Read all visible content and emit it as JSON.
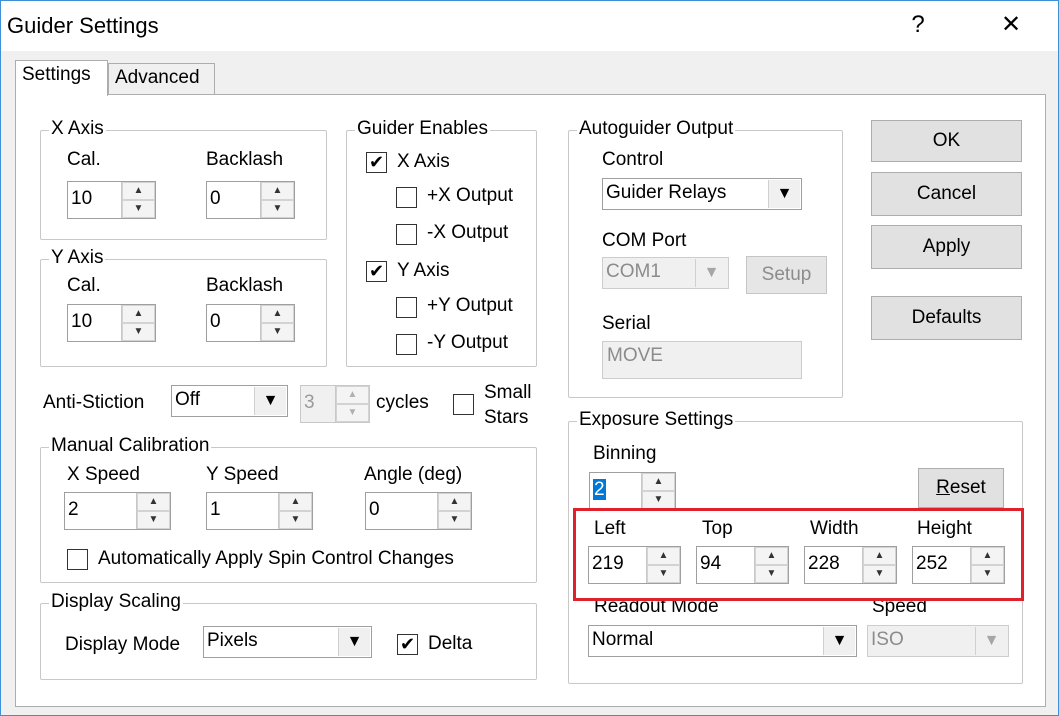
{
  "window": {
    "title": "Guider Settings",
    "help_label": "?",
    "close_label": "✕"
  },
  "tabs": [
    {
      "label": "Settings",
      "active": true
    },
    {
      "label": "Advanced",
      "active": false
    }
  ],
  "x_axis": {
    "group": "X Axis",
    "cal_label": "Cal.",
    "cal_value": "10",
    "backlash_label": "Backlash",
    "backlash_value": "0"
  },
  "y_axis": {
    "group": "Y Axis",
    "cal_label": "Cal.",
    "cal_value": "10",
    "backlash_label": "Backlash",
    "backlash_value": "0"
  },
  "guider_enables": {
    "group": "Guider Enables",
    "x_axis": {
      "label": "X Axis",
      "checked": true
    },
    "plus_x": {
      "label": "+X Output",
      "checked": false
    },
    "minus_x": {
      "label": "-X Output",
      "checked": false
    },
    "y_axis": {
      "label": "Y Axis",
      "checked": true
    },
    "plus_y": {
      "label": "+Y Output",
      "checked": false
    },
    "minus_y": {
      "label": "-Y Output",
      "checked": false
    }
  },
  "anti_stiction": {
    "label": "Anti-Stiction",
    "mode": "Off",
    "cycles_value": "3",
    "cycles_label": "cycles",
    "small_stars_label_1": "Small",
    "small_stars_label_2": "Stars"
  },
  "manual_calibration": {
    "group": "Manual Calibration",
    "x_speed_label": "X Speed",
    "x_speed_value": "2",
    "y_speed_label": "Y Speed",
    "y_speed_value": "1",
    "angle_label": "Angle (deg)",
    "angle_value": "0",
    "auto_apply_label": "Automatically Apply Spin Control Changes"
  },
  "display_scaling": {
    "group": "Display Scaling",
    "mode_label": "Display Mode",
    "mode_value": "Pixels",
    "delta_label": "Delta"
  },
  "autoguider_output": {
    "group": "Autoguider Output",
    "control_label": "Control",
    "control_value": "Guider Relays",
    "com_port_label": "COM Port",
    "com_port_value": "COM1",
    "setup_label": "Setup",
    "serial_label": "Serial",
    "serial_value": "MOVE"
  },
  "exposure_settings": {
    "group": "Exposure Settings",
    "binning_label": "Binning",
    "binning_value": "2",
    "reset_label_underlined": "R",
    "reset_label_rest": "eset",
    "left_label": "Left",
    "left_value": "219",
    "top_label": "Top",
    "top_value": "94",
    "width_label": "Width",
    "width_value": "228",
    "height_label": "Height",
    "height_value": "252",
    "readout_label": "Readout Mode",
    "readout_value": "Normal",
    "speed_label": "Speed",
    "speed_value": "ISO"
  },
  "buttons": {
    "ok": "OK",
    "cancel": "Cancel",
    "apply": "Apply",
    "defaults": "Defaults"
  },
  "icons": {
    "up_arrow": "▲",
    "down_arrow": "▼",
    "check_mark": "✔"
  },
  "colors": {
    "highlight": "#e0202a",
    "window_border": "#3c8fd8",
    "selection": "#0078d7"
  }
}
